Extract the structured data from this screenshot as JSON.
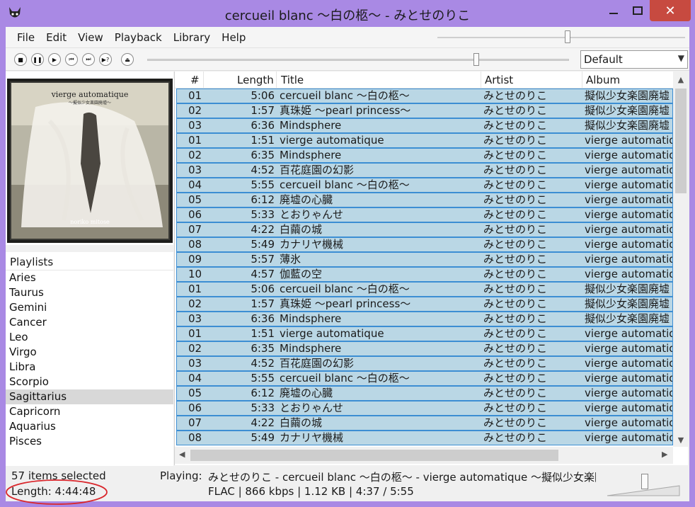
{
  "window": {
    "title": "cercueil blanc ～白の柩～ - みとせのりこ",
    "minimize_label": "—",
    "maximize_label": "☐",
    "close_label": "✕"
  },
  "menu": [
    "File",
    "Edit",
    "View",
    "Playback",
    "Library",
    "Help"
  ],
  "transport": {
    "stop_icon": "■",
    "pause_icon": "❚❚",
    "play_icon": "▶",
    "previous_icon": "⏮",
    "next_icon": "⏭",
    "random_icon": "▶?",
    "open_icon": "⏏",
    "seek_progress": 0.82,
    "volume_top_level": 0.52
  },
  "dsp_dropdown": {
    "selected": "Default"
  },
  "album_art": {
    "cover_title": "vierge automatique",
    "cover_subtitle": "～擬似少女楽園廃墟～",
    "cover_artist": "noriko mitose"
  },
  "playlists": {
    "header": "Playlists",
    "items": [
      "Aries",
      "Taurus",
      "Gemini",
      "Cancer",
      "Leo",
      "Virgo",
      "Libra",
      "Scorpio",
      "Sagittarius",
      "Capricorn",
      "Aquarius",
      "Pisces"
    ],
    "selected": "Sagittarius"
  },
  "tracklist": {
    "columns": [
      "#",
      "Length",
      "Title",
      "Artist",
      "Album"
    ],
    "rows": [
      [
        "01",
        "5:06",
        "cercueil blanc ～白の柩～",
        "みとせのりこ",
        "擬似少女楽園廃墟"
      ],
      [
        "02",
        "1:57",
        "真珠姫 ～pearl princess～",
        "みとせのりこ",
        "擬似少女楽園廃墟"
      ],
      [
        "03",
        "6:36",
        "Mindsphere",
        "みとせのりこ",
        "擬似少女楽園廃墟"
      ],
      [
        "01",
        "1:51",
        "vierge automatique",
        "みとせのりこ",
        "vierge automatique"
      ],
      [
        "02",
        "6:35",
        "Mindsphere",
        "みとせのりこ",
        "vierge automatique"
      ],
      [
        "03",
        "4:52",
        "百花庭園の幻影",
        "みとせのりこ",
        "vierge automatique"
      ],
      [
        "04",
        "5:55",
        "cercueil blanc ～白の柩～",
        "みとせのりこ",
        "vierge automatique"
      ],
      [
        "05",
        "6:12",
        "廃墟の心臓",
        "みとせのりこ",
        "vierge automatique"
      ],
      [
        "06",
        "5:33",
        "とおりゃんせ",
        "みとせのりこ",
        "vierge automatique"
      ],
      [
        "07",
        "4:22",
        "白繭の城",
        "みとせのりこ",
        "vierge automatique"
      ],
      [
        "08",
        "5:49",
        "カナリヤ機械",
        "みとせのりこ",
        "vierge automatique"
      ],
      [
        "09",
        "5:57",
        "薄氷",
        "みとせのりこ",
        "vierge automatique"
      ],
      [
        "10",
        "4:57",
        "伽藍の空",
        "みとせのりこ",
        "vierge automatique"
      ],
      [
        "01",
        "5:06",
        "cercueil blanc ～白の柩～",
        "みとせのりこ",
        "擬似少女楽園廃墟"
      ],
      [
        "02",
        "1:57",
        "真珠姫 ～pearl princess～",
        "みとせのりこ",
        "擬似少女楽園廃墟"
      ],
      [
        "03",
        "6:36",
        "Mindsphere",
        "みとせのりこ",
        "擬似少女楽園廃墟"
      ],
      [
        "01",
        "1:51",
        "vierge automatique",
        "みとせのりこ",
        "vierge automatique"
      ],
      [
        "02",
        "6:35",
        "Mindsphere",
        "みとせのりこ",
        "vierge automatique"
      ],
      [
        "03",
        "4:52",
        "百花庭園の幻影",
        "みとせのりこ",
        "vierge automatique"
      ],
      [
        "04",
        "5:55",
        "cercueil blanc ～白の柩～",
        "みとせのりこ",
        "vierge automatique"
      ],
      [
        "05",
        "6:12",
        "廃墟の心臓",
        "みとせのりこ",
        "vierge automatique"
      ],
      [
        "06",
        "5:33",
        "とおりゃんせ",
        "みとせのりこ",
        "vierge automatique"
      ],
      [
        "07",
        "4:22",
        "白繭の城",
        "みとせのりこ",
        "vierge automatique"
      ],
      [
        "08",
        "5:49",
        "カナリヤ機械",
        "みとせのりこ",
        "vierge automatique"
      ]
    ],
    "row_bg_color": "#bad7e5",
    "row_border_color": "#3c8ed3"
  },
  "status": {
    "selected_count": "57 items selected",
    "total_length": "Length: 4:44:48",
    "playing_label": "Playing:",
    "now_playing": "みとせのりこ - cercueil blanc ～白の柩～ - vierge automatique ～擬似少女楽園廃",
    "stream_info": "FLAC | 866 kbps | 1.12 KB | 4:37 / 5:55",
    "volume_level": 0.55
  },
  "colors": {
    "window_frame": "#a989e4",
    "close_button": "#c74a40",
    "annotation_circle": "#d9262b"
  }
}
